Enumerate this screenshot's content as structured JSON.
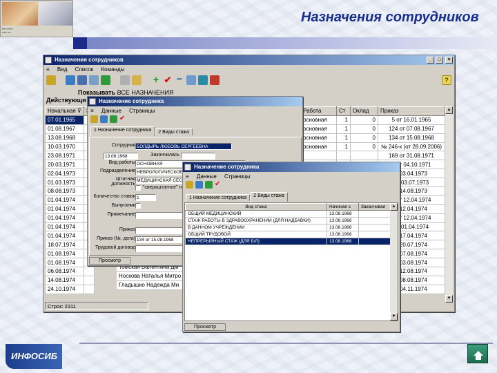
{
  "slide": {
    "title": "Назначения сотрудников",
    "brand": "ИНФОСИБ"
  },
  "main_window": {
    "title": "Назначения сотрудников",
    "menu": [
      "Вид",
      "Список",
      "Команды"
    ],
    "filter_label": "Показывать",
    "filter_value": "ВСЕ НАЗНАЧЕНИЯ",
    "left_label": "Действующи",
    "columns_left": [
      "Начальная",
      "З"
    ],
    "columns_right": [
      "Работа",
      "Ст",
      "Оклад",
      "Приказ"
    ],
    "rows_left": [
      "07.01.1965",
      "01.08.1967",
      "13.08.1968",
      "10.03.1970",
      "23.08.1971",
      "20.03.1971",
      "02.04.1973",
      "01.03.1973",
      "08.08.1973",
      "01.04.1974",
      "01.04.1974",
      "01.04.1974",
      "01.04.1974",
      "01.04.1974",
      "18.07.1974",
      "01.08.1974",
      "01.08.1974",
      "06.08.1974",
      "14.08.1974",
      "24.10.1974"
    ],
    "rows_names": [
      "Томская Валентина Дм",
      "Носкова Наталья Митро",
      "Гладышко Надежда Ми"
    ],
    "rows_right": [
      [
        "основная",
        "1",
        "0",
        "5 от 16.01.1965"
      ],
      [
        "основная",
        "1",
        "0",
        "124 от 07.08.1967"
      ],
      [
        "основная",
        "1",
        "0",
        "134 от 15.08.1968"
      ],
      [
        "основная",
        "1",
        "0",
        "№ 246-к (от 28.09.2006)"
      ],
      [
        "",
        "",
        "",
        "169 от 31.08.1971"
      ],
      [
        "",
        "",
        "",
        "6 от 04.10.1971"
      ],
      [
        "",
        "",
        "",
        "т 03.04.1973"
      ],
      [
        "",
        "",
        "",
        "от 03.07.1973"
      ],
      [
        "",
        "",
        "",
        "т 14.08.1973"
      ],
      [
        "",
        "",
        "",
        "3 от 12.04.1974"
      ],
      [
        "",
        "",
        "",
        "т 12.04.1974"
      ],
      [
        "",
        "",
        "",
        "1 от 12.04.1974"
      ],
      [
        "",
        "",
        "",
        "от 01.04.1974"
      ],
      [
        "",
        "",
        "",
        "т 17.04.1974"
      ],
      [
        "",
        "",
        "",
        "т 20.07.1974"
      ],
      [
        "",
        "",
        "",
        "т 07.08.1974"
      ],
      [
        "",
        "",
        "",
        "т 03.08.1974"
      ],
      [
        "",
        "",
        "",
        "т 12.08.1974"
      ],
      [
        "",
        "",
        "",
        "т 08.08.1974"
      ],
      [
        "",
        "",
        "",
        "т 04.11.1974"
      ]
    ],
    "status": "Строк: 2311"
  },
  "dialog1": {
    "title": "Назначение сотрудника",
    "menu": [
      "Данные",
      "Страницы"
    ],
    "tabs": [
      "1 Назначение сотрудника",
      "2 Виды стажа"
    ],
    "fields": [
      {
        "label": "Сотрудник",
        "value": "БОЛДЫРЬ ЛЮБОВЬ СЕРГЕЕВНА"
      },
      {
        "label": "Начальная с",
        "value": "13.08.1968"
      },
      {
        "label": "Закончилась",
        "value": ""
      },
      {
        "label": "Вид работы",
        "value": "ОСНОВНАЯ"
      },
      {
        "label": "Подразделение",
        "value": "НЕВРОЛОГИЧЕСКОЕ"
      },
      {
        "label": "Штатная должность",
        "value": "МЕДИЦИНСКАЯ СЕСТ"
      },
      {
        "label": "",
        "value": "\"сверхштатное\" на"
      },
      {
        "label": "Количество ставок",
        "value": "1"
      },
      {
        "label": "Выпускник",
        "value": ""
      },
      {
        "label": "Примечание",
        "value": ""
      },
      {
        "label": "Приказ",
        "value": ""
      },
      {
        "label": "Приказ (№, дата)",
        "value": "134 от 15.08.1968"
      },
      {
        "label": "Трудовой договор",
        "value": ""
      }
    ],
    "button": "Просмотр"
  },
  "dialog2": {
    "title": "Назначение сотрудника",
    "menu": [
      "Данные",
      "Страницы"
    ],
    "tabs": [
      "1 Назначение сотрудника",
      "2 Виды стажа"
    ],
    "columns": [
      "Вид стажа",
      "Начиная с",
      "Заканчивая"
    ],
    "rows": [
      [
        "ОБЩИЙ МЕДИЦИНСКИЙ",
        "13.08.1968",
        ""
      ],
      [
        "СТАЖ РАБОТЫ В ЗДРАВООХРАНЕНИИ (ДЛЯ НАДБАВКИ)",
        "13.08.1968",
        ""
      ],
      [
        "В ДАННОМ УЧРЕЖДЕНИИ",
        "13.08.1968",
        ""
      ],
      [
        "ОБЩИЙ ТРУДОВОЙ",
        "13.08.1968",
        ""
      ],
      [
        "НЕПРЕРЫВНЫЙ СТАЖ (ДЛЯ Б/Л)",
        "13.08.1968",
        ""
      ]
    ],
    "selected_row": 4,
    "button": "Просмотр"
  },
  "colors": {
    "title": "#1a2f8a",
    "titlebar": "#0a246a",
    "selection": "#0a246a"
  }
}
